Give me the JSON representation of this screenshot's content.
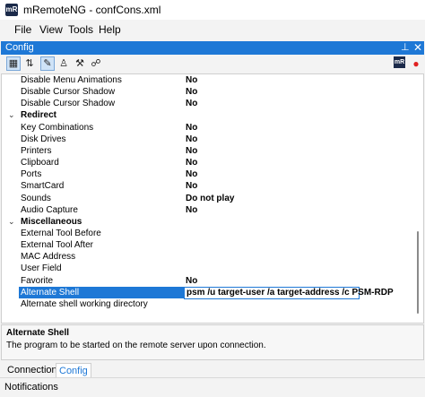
{
  "window": {
    "title": "mRemoteNG - confCons.xml",
    "app_icon": "mR"
  },
  "menu": [
    "File",
    "View",
    "Tools",
    "Help"
  ],
  "panel": {
    "title": "Config",
    "pin_icon": "pin-icon",
    "close_icon": "close-icon"
  },
  "toolbar": {
    "buttons": [
      "categorized-icon",
      "alphabetical-icon",
      "properties-icon",
      "default-inheritance-icon",
      "inheritance-icon",
      "hosts-icon"
    ],
    "right": [
      "mremoteng-icon",
      "record-icon"
    ]
  },
  "grid": {
    "rows": [
      {
        "type": "prop",
        "name": "Disable Menu Animations",
        "value": "No"
      },
      {
        "type": "prop",
        "name": "Disable Cursor Shadow",
        "value": "No"
      },
      {
        "type": "prop",
        "name": "Disable Cursor Shadow",
        "value": "No"
      },
      {
        "type": "cat",
        "name": "Redirect",
        "value": ""
      },
      {
        "type": "prop",
        "name": "Key Combinations",
        "value": "No"
      },
      {
        "type": "prop",
        "name": "Disk Drives",
        "value": "No"
      },
      {
        "type": "prop",
        "name": "Printers",
        "value": "No"
      },
      {
        "type": "prop",
        "name": "Clipboard",
        "value": "No"
      },
      {
        "type": "prop",
        "name": "Ports",
        "value": "No"
      },
      {
        "type": "prop",
        "name": "SmartCard",
        "value": "No"
      },
      {
        "type": "prop",
        "name": "Sounds",
        "value": "Do not play"
      },
      {
        "type": "prop",
        "name": "Audio Capture",
        "value": "No"
      },
      {
        "type": "cat",
        "name": "Miscellaneous",
        "value": ""
      },
      {
        "type": "prop",
        "name": "External Tool Before",
        "value": ""
      },
      {
        "type": "prop",
        "name": "External Tool After",
        "value": ""
      },
      {
        "type": "prop",
        "name": "MAC Address",
        "value": ""
      },
      {
        "type": "prop",
        "name": "User Field",
        "value": ""
      },
      {
        "type": "prop",
        "name": "Favorite",
        "value": "No"
      },
      {
        "type": "selected",
        "name": "Alternate Shell",
        "value": "psm /u target-user /a target-address /c PSM-RDP"
      },
      {
        "type": "prop",
        "name": "Alternate shell working directory",
        "value": ""
      }
    ]
  },
  "help": {
    "title": "Alternate Shell",
    "description": "The program to be started on the remote server upon connection."
  },
  "tabs": [
    {
      "label": "Connections",
      "active": false
    },
    {
      "label": "Config",
      "active": true
    }
  ],
  "status": {
    "notifications": "Notifications"
  },
  "colors": {
    "accent": "#1e78d6"
  }
}
